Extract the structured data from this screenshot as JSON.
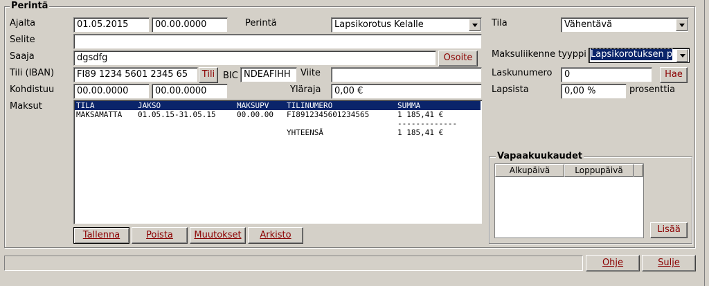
{
  "group_title": "Perintä",
  "labels": {
    "ajalta": "Ajalta",
    "perinta": "Perintä",
    "tila": "Tila",
    "selite": "Selite",
    "saaja": "Saaja",
    "maksuliikenne": "Maksuliikenne tyyppi",
    "tili_iban": "Tili (IBAN)",
    "bic": "BIC",
    "viite": "Viite",
    "laskunumero": "Laskunumero",
    "kohdistuu": "Kohdistuu",
    "ylaraja": "Yläraja",
    "lapsista": "Lapsista",
    "prosenttia": "prosenttia",
    "maksut": "Maksut"
  },
  "fields": {
    "ajalta_from": "01.05.2015",
    "ajalta_to": "00.00.0000",
    "perinta": "Lapsikorotus Kelalle",
    "tila": "Vähentävä",
    "selite": "",
    "saaja": "dgsdfg",
    "maksuliikenne": "Lapsikorotuksen p",
    "iban": "FI89 1234 5601 2345 65",
    "bic": "NDEAFIHH",
    "viite": "",
    "laskunumero": "0",
    "kohdistuu_from": "00.00.0000",
    "kohdistuu_to": "00.00.0000",
    "ylaraja": "0,00 €",
    "lapsista": "0,00 %"
  },
  "buttons": {
    "osoite": "Osoite",
    "tili": "Tili",
    "hae": "Hae",
    "tallenna": "Tallenna",
    "poista": "Poista",
    "muutokset": "Muutokset",
    "arkisto": "Arkisto",
    "lisaa": "Lisää",
    "ohje": "Ohje",
    "sulje": "Sulje"
  },
  "payments": {
    "headers": [
      "TILA",
      "JAKSO",
      "MAKSUPV",
      "TILINUMERO",
      "SUMMA"
    ],
    "rows": [
      [
        "MAKSAMATTA",
        "01.05.15-31.05.15",
        "00.00.00",
        "FI8912345601234565",
        "1 185,41 €"
      ]
    ],
    "separator": "-------------",
    "total_label": "YHTEENSÄ",
    "total_value": "1 185,41 €"
  },
  "vapaakuukaudet": {
    "title": "Vapaakuukaudet",
    "headers": [
      "Alkupäivä",
      "Loppupäivä"
    ]
  },
  "status_bar": ""
}
